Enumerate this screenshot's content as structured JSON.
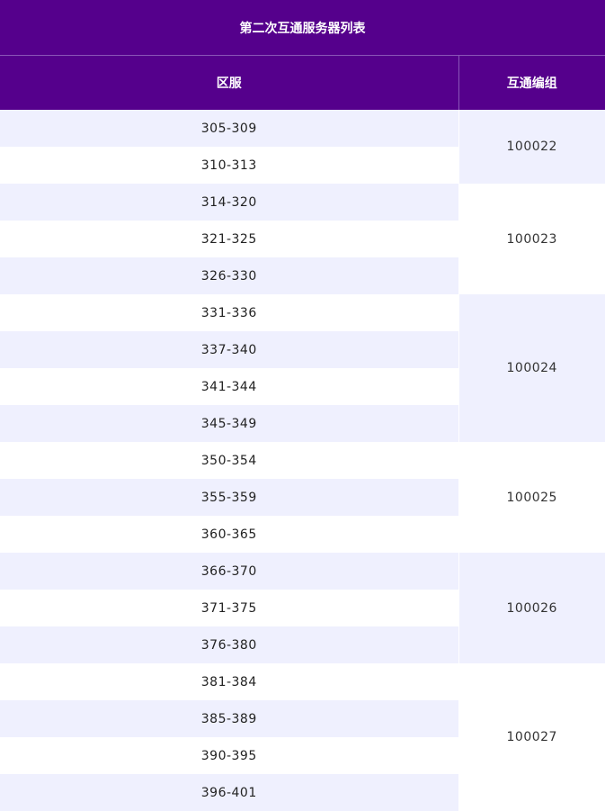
{
  "table": {
    "title": "第二次互通服务器列表",
    "headers": {
      "zone": "区服",
      "group": "互通编组"
    },
    "groups": [
      {
        "group_id": "100022",
        "zones": [
          "305-309",
          "310-313"
        ]
      },
      {
        "group_id": "100023",
        "zones": [
          "314-320",
          "321-325",
          "326-330"
        ]
      },
      {
        "group_id": "100024",
        "zones": [
          "331-336",
          "337-340",
          "341-344",
          "345-349"
        ]
      },
      {
        "group_id": "100025",
        "zones": [
          "350-354",
          "355-359",
          "360-365"
        ]
      },
      {
        "group_id": "100026",
        "zones": [
          "366-370",
          "371-375",
          "376-380"
        ]
      },
      {
        "group_id": "100027",
        "zones": [
          "381-384",
          "385-389",
          "390-395",
          "396-401"
        ]
      }
    ]
  },
  "colors": {
    "header_bg": "#55008c",
    "row_tint": "#eff0fe",
    "row_white": "#ffffff"
  }
}
